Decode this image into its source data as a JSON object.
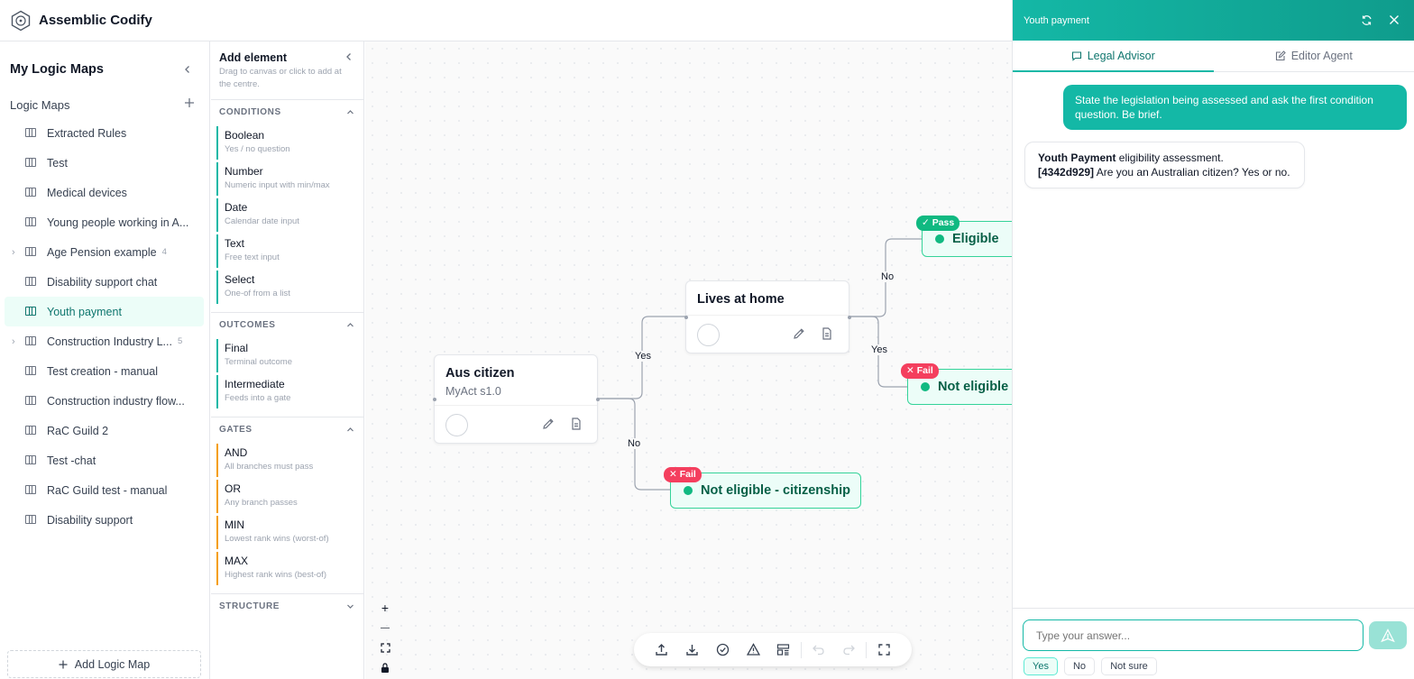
{
  "app": {
    "title": "Assemblic Codify"
  },
  "sidebar": {
    "title": "My Logic Maps",
    "section_label": "Logic Maps",
    "items": [
      {
        "label": "Extracted Rules"
      },
      {
        "label": "Test"
      },
      {
        "label": "Medical devices"
      },
      {
        "label": "Young people working in A..."
      },
      {
        "label": "Age Pension example",
        "count": "4",
        "expandable": true
      },
      {
        "label": "Disability support chat"
      },
      {
        "label": "Youth payment",
        "active": true
      },
      {
        "label": "Construction Industry L...",
        "count": "5",
        "expandable": true
      },
      {
        "label": "Test creation - manual"
      },
      {
        "label": "Construction industry flow..."
      },
      {
        "label": "RaC Guild 2"
      },
      {
        "label": "Test -chat"
      },
      {
        "label": "RaC Guild test - manual"
      },
      {
        "label": "Disability support"
      }
    ],
    "add_label": "Add Logic Map"
  },
  "palette": {
    "title": "Add element",
    "description": "Drag to canvas or click to add at the centre.",
    "sections": {
      "conditions": {
        "label": "CONDITIONS",
        "items": [
          {
            "name": "Boolean",
            "desc": "Yes / no question"
          },
          {
            "name": "Number",
            "desc": "Numeric input with min/max"
          },
          {
            "name": "Date",
            "desc": "Calendar date input"
          },
          {
            "name": "Text",
            "desc": "Free text input"
          },
          {
            "name": "Select",
            "desc": "One-of from a list"
          }
        ]
      },
      "outcomes": {
        "label": "OUTCOMES",
        "items": [
          {
            "name": "Final",
            "desc": "Terminal outcome"
          },
          {
            "name": "Intermediate",
            "desc": "Feeds into a gate"
          }
        ]
      },
      "gates": {
        "label": "GATES",
        "items": [
          {
            "name": "AND",
            "desc": "All branches must pass"
          },
          {
            "name": "OR",
            "desc": "Any branch passes"
          },
          {
            "name": "MIN",
            "desc": "Lowest rank wins (worst-of)"
          },
          {
            "name": "MAX",
            "desc": "Highest rank wins (best-of)"
          }
        ]
      },
      "structure": {
        "label": "STRUCTURE"
      }
    }
  },
  "canvas": {
    "nodes": {
      "aus_citizen": {
        "title": "Aus citizen",
        "subtitle": "MyAct s1.0"
      },
      "lives_at_home": {
        "title": "Lives at home"
      }
    },
    "outcomes": {
      "eligible": {
        "label": "Eligible",
        "badge": "✓ Pass"
      },
      "not_eligible": {
        "label": "Not eligible",
        "badge": "✕ Fail"
      },
      "not_eligible_citizenship": {
        "label": "Not eligible - citizenship",
        "badge": "✕ Fail"
      }
    },
    "edge_labels": {
      "yes1": "Yes",
      "no1": "No",
      "no2": "No",
      "yes2": "Yes"
    },
    "zoom_controls": {
      "zoom_in": "+",
      "zoom_out": "—"
    }
  },
  "chat": {
    "title": "Youth payment",
    "tabs": [
      {
        "label": "Legal Advisor"
      },
      {
        "label": "Editor Agent"
      }
    ],
    "messages": {
      "user": "State the legislation being assessed and ask the first condition question. Be brief.",
      "bot_bold": "Youth Payment",
      "bot_text": " eligibility assessment.",
      "bot_ref": "[4342d929]",
      "bot_question": " Are you an Australian citizen? Yes or no."
    },
    "input_placeholder": "Type your answer...",
    "quick_replies": [
      "Yes",
      "No",
      "Not sure"
    ]
  },
  "colors": {
    "accent": "#14b8a6",
    "pass": "#10b981",
    "fail": "#f43f5e",
    "gate": "#f59e0b"
  }
}
